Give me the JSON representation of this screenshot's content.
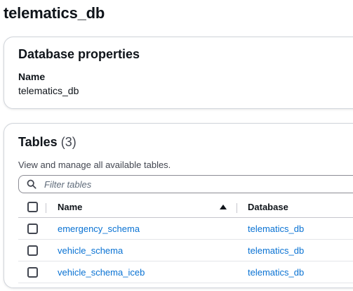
{
  "page": {
    "title": "telematics_db"
  },
  "properties": {
    "heading": "Database properties",
    "name_label": "Name",
    "name_value": "telematics_db"
  },
  "tables": {
    "heading": "Tables",
    "count": "(3)",
    "description": "View and manage all available tables.",
    "filter_placeholder": "Filter tables",
    "columns": {
      "name": "Name",
      "database": "Database"
    },
    "rows": [
      {
        "name": "emergency_schema",
        "database": "telematics_db"
      },
      {
        "name": "vehicle_schema",
        "database": "telematics_db"
      },
      {
        "name": "vehicle_schema_iceb",
        "database": "telematics_db"
      }
    ]
  },
  "colors": {
    "link": "#0972d3",
    "text": "#0f141a",
    "border": "#d1d5db"
  },
  "icons": {
    "search": "search-icon",
    "sort": "sort-ascending-icon"
  }
}
